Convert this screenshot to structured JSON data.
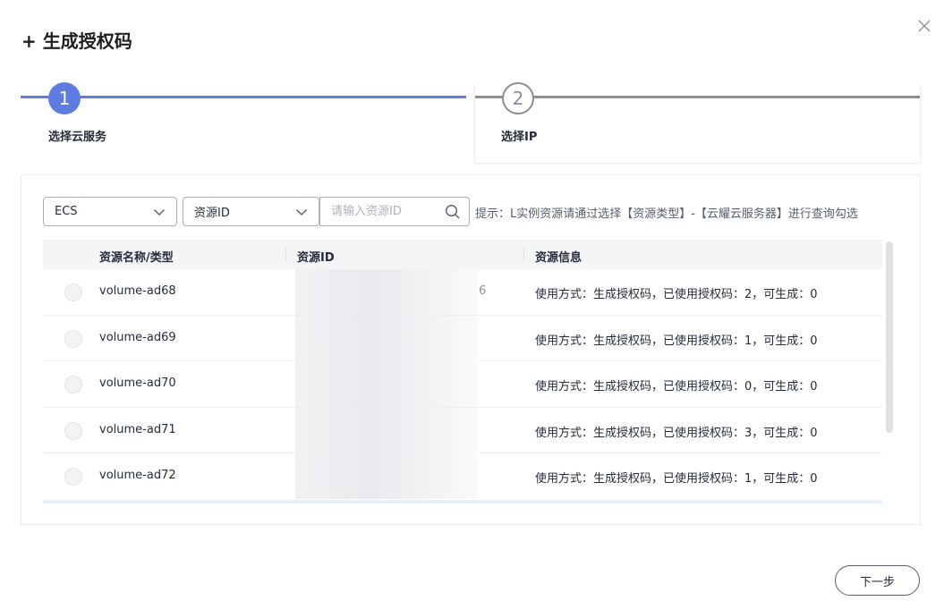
{
  "dialog": {
    "title": "+ 生成授权码",
    "close_icon": "close-icon"
  },
  "steps": [
    {
      "number": "1",
      "label": "选择云服务",
      "state": "active"
    },
    {
      "number": "2",
      "label": "选择IP",
      "state": "pending"
    }
  ],
  "filters": {
    "resource_type": {
      "selected": "ECS"
    },
    "search_field": {
      "selected": "资源ID"
    },
    "search": {
      "placeholder": "请输入资源ID",
      "value": ""
    },
    "hint": "提示：L实例资源请通过选择【资源类型】-【云耀云服务器】进行查询勾选"
  },
  "table": {
    "columns": [
      "资源名称/类型",
      "资源ID",
      "资源信息"
    ],
    "rows": [
      {
        "name": "volume-ad68",
        "id_tail": "6",
        "info": "使用方式：生成授权码，已使用授权码：2，可生成：0"
      },
      {
        "name": "volume-ad69",
        "id_tail": "",
        "info": "使用方式：生成授权码，已使用授权码：1，可生成：0"
      },
      {
        "name": "volume-ad70",
        "id_tail": "",
        "info": "使用方式：生成授权码，已使用授权码：0，可生成：0"
      },
      {
        "name": "volume-ad71",
        "id_tail": "",
        "info": "使用方式：生成授权码，已使用授权码：3，可生成：0"
      },
      {
        "name": "volume-ad72",
        "id_tail": "",
        "info": "使用方式：生成授权码，已使用授权码：1，可生成：0"
      }
    ]
  },
  "footer": {
    "next_label": "下一步"
  },
  "colors": {
    "accent": "#5e7ce0",
    "inactive": "#8a8e99",
    "text": "#252b3a"
  }
}
